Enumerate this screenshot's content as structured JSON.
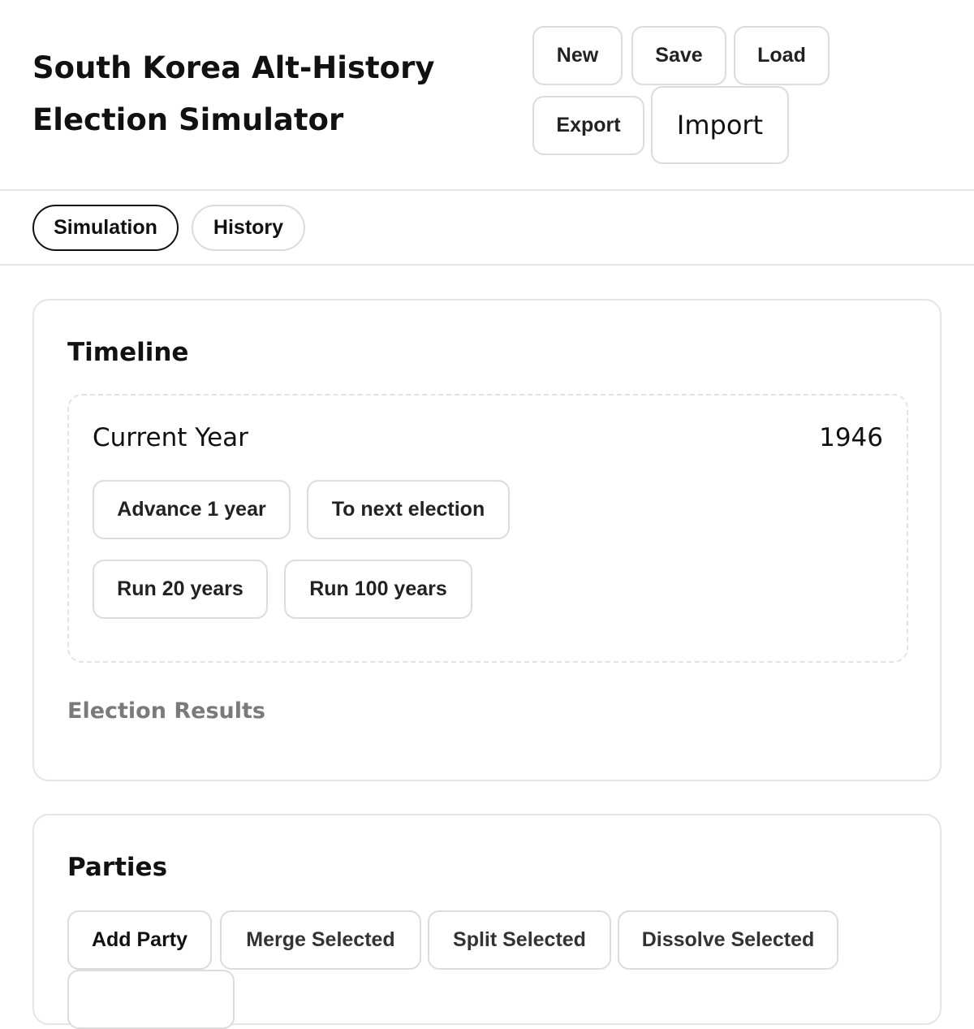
{
  "header": {
    "title_line1": "South Korea Alt-History",
    "title_line2": "Election Simulator",
    "buttons": {
      "new": "New",
      "save": "Save",
      "load": "Load",
      "export": "Export",
      "import": "Import"
    }
  },
  "tabs": [
    {
      "label": "Simulation",
      "active": true
    },
    {
      "label": "History",
      "active": false
    }
  ],
  "timeline": {
    "title": "Timeline",
    "current_year_label": "Current Year",
    "current_year": "1946",
    "buttons": {
      "advance_1_year": "Advance 1 year",
      "to_next_election": "To next election",
      "run_20_years": "Run 20 years",
      "run_100_years": "Run 100 years"
    },
    "results_label": "Election Results"
  },
  "parties": {
    "title": "Parties",
    "buttons": {
      "add_party": "Add Party",
      "merge_selected": "Merge Selected",
      "split_selected": "Split Selected",
      "dissolve_selected": "Dissolve Selected"
    }
  }
}
